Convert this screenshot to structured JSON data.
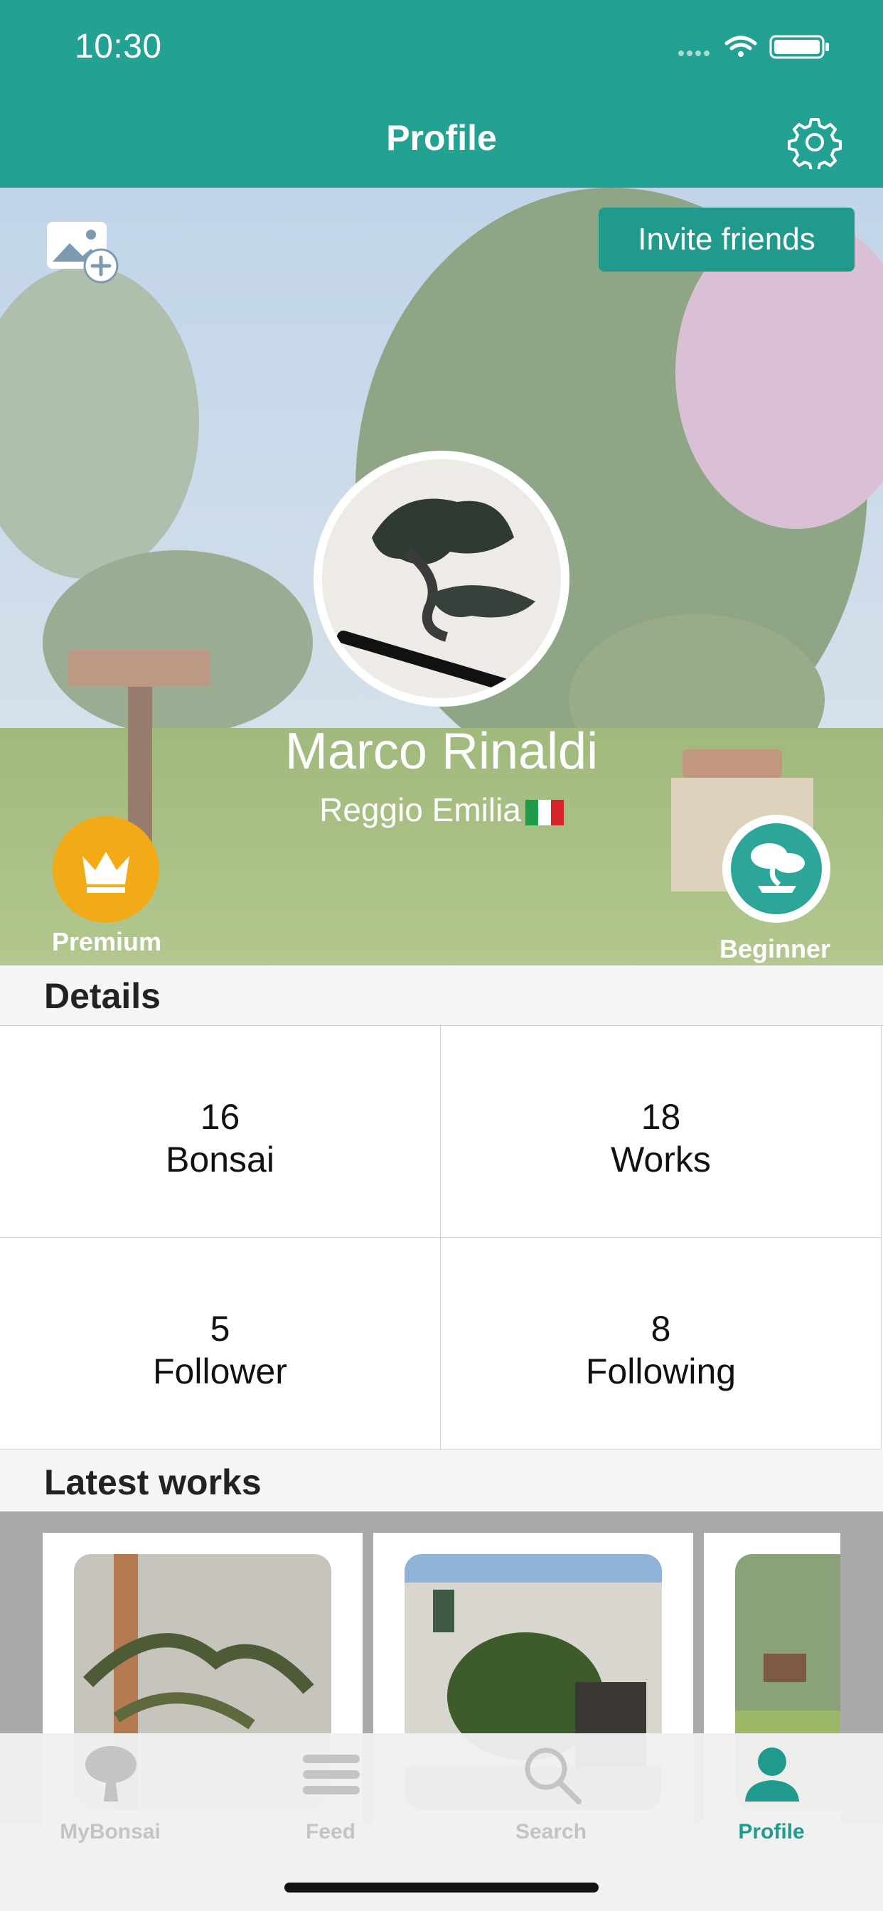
{
  "status_bar": {
    "time": "10:30"
  },
  "header": {
    "title": "Profile",
    "settings_icon": "gear-icon"
  },
  "hero": {
    "invite_label": "Invite friends",
    "name": "Marco Rinaldi",
    "location": "Reggio Emilia",
    "flag_icon": "italy-flag-icon",
    "premium_label": "Premium",
    "level_label": "Beginner",
    "premium_color": "#f2ab17",
    "level_color": "#2ba699"
  },
  "details": {
    "title": "Details",
    "stats": [
      {
        "value": "16",
        "label": "Bonsai"
      },
      {
        "value": "18",
        "label": "Works"
      },
      {
        "value": "5",
        "label": "Follower"
      },
      {
        "value": "8",
        "label": "Following"
      }
    ]
  },
  "latest_works": {
    "title": "Latest works"
  },
  "tabbar": {
    "tabs": [
      {
        "label": "MyBonsai",
        "icon": "tree-icon"
      },
      {
        "label": "Feed",
        "icon": "menu-icon"
      },
      {
        "label": "Search",
        "icon": "search-icon"
      },
      {
        "label": "Profile",
        "icon": "person-icon"
      }
    ],
    "active_color": "#1f9a8c"
  },
  "theme": {
    "accent": "#23a293"
  }
}
